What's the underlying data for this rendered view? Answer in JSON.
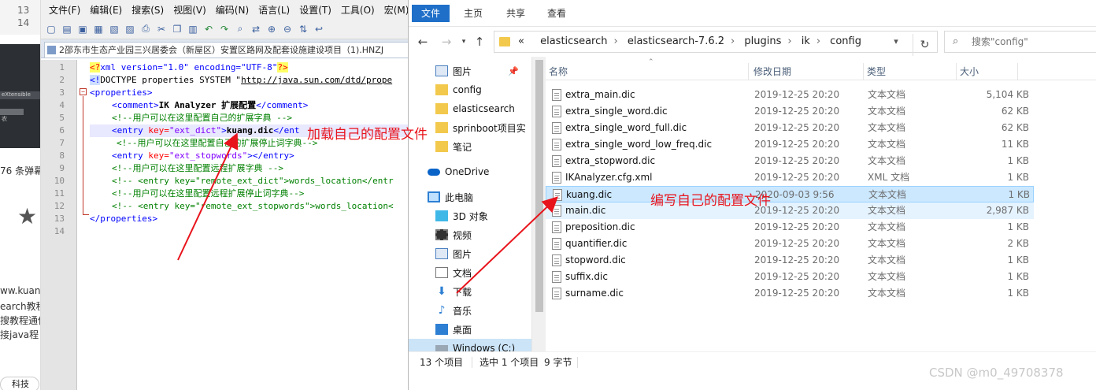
{
  "left_strip": {
    "line_numbers": [
      "13",
      "14"
    ],
    "thumb_caption": "eXtensible",
    "thumb_caption2": "农",
    "comments_count": "76 条弹幕",
    "url_fragments": [
      "ww.kuang",
      "earch教程",
      "搜教程通俗",
      "接java程"
    ],
    "badge": "科技"
  },
  "editor": {
    "menu": [
      "文件(F)",
      "编辑(E)",
      "搜索(S)",
      "视图(V)",
      "编码(N)",
      "语言(L)",
      "设置(T)",
      "工具(O)",
      "宏(M)"
    ],
    "tab_title": "2邵东市生态产业园三兴居委会（新屋区）安置区路网及配套设施建设项目（1).HNZJ",
    "line_numbers": [
      "1",
      "2",
      "3",
      "4",
      "5",
      "6",
      "7",
      "8",
      "9",
      "10",
      "11",
      "12",
      "13",
      "14"
    ],
    "lines": {
      "l1_a": "<?",
      "l1_b": "xml version=\"1.0\" encoding=\"UTF-8\"",
      "l1_c": "?>",
      "l2_a": "<!",
      "l2_b": "DOCTYPE properties SYSTEM \"",
      "l2_c": "http://java.sun.com/dtd/prope",
      "l3": "<properties>",
      "l4_a": "<comment>",
      "l4_b": "IK Analyzer 扩展配置",
      "l4_c": "</comment>",
      "l5": "<!--用户可以在这里配置自己的扩展字典 -->",
      "l6_a": "<entry ",
      "l6_b": "key=",
      "l6_c": "\"ext_dict\"",
      "l6_d": ">",
      "l6_e": "kuang.dic",
      "l6_f": "</ent",
      "l7": "<!--用户可以在这里配置自己的扩展停止词字典-->",
      "l8_a": "<entry ",
      "l8_b": "key=",
      "l8_c": "\"ext_stopwords\"",
      "l8_d": "></entry>",
      "l9": "<!--用户可以在这里配置远程扩展字典 -->",
      "l10_a": "<!-- <entry key=\"remote_ext_dict\">",
      "l10_b": "words_location</entr",
      "l11": "<!--用户可以在这里配置远程扩展停止词字典-->",
      "l12_a": "<!-- <entry key=\"remote_ext_stopwords\">",
      "l12_b": "words_location<",
      "l13": "</properties>"
    }
  },
  "explorer": {
    "ribbon_tabs": [
      "文件",
      "主页",
      "共享",
      "查看"
    ],
    "breadcrumb": [
      "«",
      "elasticsearch",
      "elasticsearch-7.6.2",
      "plugins",
      "ik",
      "config"
    ],
    "search_placeholder": "搜索\"config\"",
    "nav_items": [
      {
        "label": "图片",
        "icon": "pictures-icon"
      },
      {
        "label": "config",
        "icon": "folder-icon"
      },
      {
        "label": "elasticsearch",
        "icon": "folder-icon"
      },
      {
        "label": "sprinboot项目实",
        "icon": "folder-icon"
      },
      {
        "label": "笔记",
        "icon": "folder-icon"
      },
      {
        "label": "OneDrive",
        "icon": "onedrive-icon"
      },
      {
        "label": "此电脑",
        "icon": "computer-icon"
      },
      {
        "label": "3D 对象",
        "icon": "3d-objects-icon"
      },
      {
        "label": "视频",
        "icon": "videos-icon"
      },
      {
        "label": "图片",
        "icon": "pictures-icon"
      },
      {
        "label": "文档",
        "icon": "documents-icon"
      },
      {
        "label": "下载",
        "icon": "downloads-icon"
      },
      {
        "label": "音乐",
        "icon": "music-icon"
      },
      {
        "label": "桌面",
        "icon": "desktop-icon"
      },
      {
        "label": "Windows (C:)",
        "icon": "drive-icon"
      }
    ],
    "columns": {
      "name": "名称",
      "date": "修改日期",
      "type": "类型",
      "size": "大小"
    },
    "files": [
      {
        "name": "extra_main.dic",
        "date": "2019-12-25 20:20",
        "type": "文本文档",
        "size": "5,104 KB"
      },
      {
        "name": "extra_single_word.dic",
        "date": "2019-12-25 20:20",
        "type": "文本文档",
        "size": "62 KB"
      },
      {
        "name": "extra_single_word_full.dic",
        "date": "2019-12-25 20:20",
        "type": "文本文档",
        "size": "62 KB"
      },
      {
        "name": "extra_single_word_low_freq.dic",
        "date": "2019-12-25 20:20",
        "type": "文本文档",
        "size": "11 KB"
      },
      {
        "name": "extra_stopword.dic",
        "date": "2019-12-25 20:20",
        "type": "文本文档",
        "size": "1 KB"
      },
      {
        "name": "IKAnalyzer.cfg.xml",
        "date": "2019-12-25 20:20",
        "type": "XML 文档",
        "size": "1 KB"
      },
      {
        "name": "kuang.dic",
        "date": "2020-09-03 9:56",
        "type": "文本文档",
        "size": "1 KB"
      },
      {
        "name": "main.dic",
        "date": "2019-12-25 20:20",
        "type": "文本文档",
        "size": "2,987 KB"
      },
      {
        "name": "preposition.dic",
        "date": "2019-12-25 20:20",
        "type": "文本文档",
        "size": "1 KB"
      },
      {
        "name": "quantifier.dic",
        "date": "2019-12-25 20:20",
        "type": "文本文档",
        "size": "2 KB"
      },
      {
        "name": "stopword.dic",
        "date": "2019-12-25 20:20",
        "type": "文本文档",
        "size": "1 KB"
      },
      {
        "name": "suffix.dic",
        "date": "2019-12-25 20:20",
        "type": "文本文档",
        "size": "1 KB"
      },
      {
        "name": "surname.dic",
        "date": "2019-12-25 20:20",
        "type": "文本文档",
        "size": "1 KB"
      }
    ],
    "status": {
      "count": "13 个项目",
      "selected": "选中 1 个项目",
      "sel_size": "9 字节"
    }
  },
  "annotations": {
    "load_config": "加载自己的配置文件",
    "write_config": "编写自己的配置文件",
    "color": "#e8141c"
  },
  "watermark": "CSDN @m0_49708378"
}
